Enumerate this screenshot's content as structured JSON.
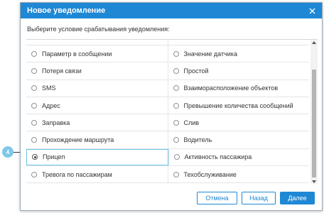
{
  "dialog": {
    "title": "Новое уведомление",
    "subtitle": "Выберите условие срабатывания уведомления:"
  },
  "conditions": [
    [
      "",
      ""
    ],
    [
      "Параметр в сообщении",
      "Значение датчика"
    ],
    [
      "Потеря связи",
      "Простой"
    ],
    [
      "SMS",
      "Взаиморасположение объектов"
    ],
    [
      "Адрес",
      "Превышение количества сообщений"
    ],
    [
      "Заправка",
      "Слив"
    ],
    [
      "Прохождение маршрута",
      "Водитель"
    ],
    [
      "Прицеп",
      "Активность пассажира"
    ],
    [
      "Тревога по пассажирам",
      "Техобслуживание"
    ]
  ],
  "selected": "Прицеп",
  "buttons": {
    "cancel": "Отмена",
    "back": "Назад",
    "next": "Далее"
  },
  "step_badge": "4",
  "colors": {
    "header": "#1e88d4",
    "selection_border": "#6ec3e6",
    "badge": "#7ec8e8"
  }
}
